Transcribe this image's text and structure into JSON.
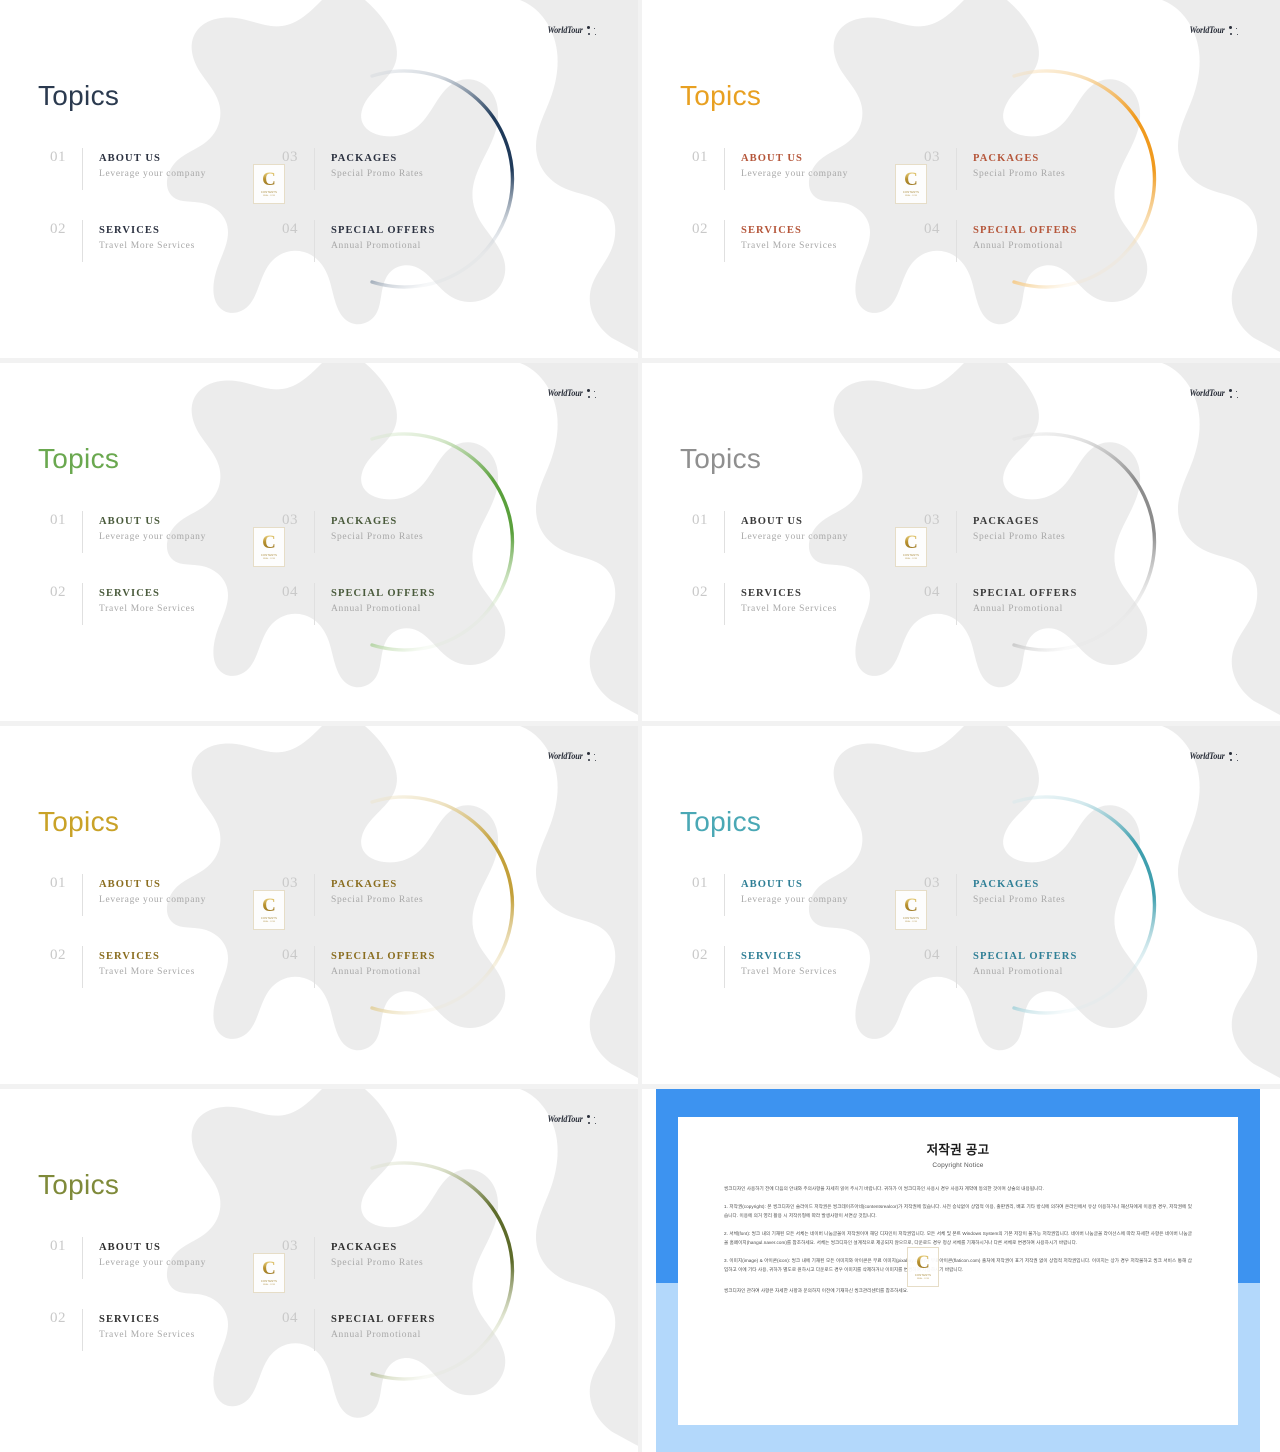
{
  "page": {
    "background": "#f2f2f2",
    "layout": "2x4 slide thumbnail grid"
  },
  "brand": {
    "name": "WorldTour",
    "sparkle_icon": "sparkle-icon"
  },
  "badge": {
    "letter": "C",
    "word": "CONTENTS",
    "tagline": "REAL .COM"
  },
  "slide_common": {
    "title": "Topics",
    "items": [
      {
        "num": "01",
        "head": "ABOUT US",
        "sub": "Leverage your company"
      },
      {
        "num": "03",
        "head": "PACKAGES",
        "sub": "Special Promo Rates"
      },
      {
        "num": "02",
        "head": "SERVICES",
        "sub": "Travel More Services"
      },
      {
        "num": "04",
        "head": "SPECIAL OFFERS",
        "sub": "Annual Promotional"
      }
    ]
  },
  "slides": [
    {
      "id": "slide-navy",
      "theme": "navy",
      "title_color": "#2b3a4f",
      "head_color": "#2b3140",
      "arc_color": "#1f3a5a",
      "arc_color_light": "#c7ced6"
    },
    {
      "id": "slide-orange",
      "theme": "orange",
      "title_color": "#e8a021",
      "head_color": "#b5563a",
      "arc_color": "#f09a1e",
      "arc_color_light": "#f7d9a8"
    },
    {
      "id": "slide-green",
      "theme": "green",
      "title_color": "#6aa84f",
      "head_color": "#4a5b3c",
      "arc_color": "#5aa03c",
      "arc_color_light": "#cfe4c2"
    },
    {
      "id": "slide-gray",
      "theme": "gray",
      "title_color": "#8f8f8f",
      "head_color": "#3a3a3a",
      "arc_color": "#8c8c8c",
      "arc_color_light": "#dcdcdc"
    },
    {
      "id": "slide-gold",
      "theme": "gold",
      "title_color": "#c9a227",
      "head_color": "#8a6d1f",
      "arc_color": "#c3a03a",
      "arc_color_light": "#ecdfba"
    },
    {
      "id": "slide-teal",
      "theme": "teal",
      "title_color": "#4aa8b5",
      "head_color": "#2f7f96",
      "arc_color": "#3f9fae",
      "arc_color_light": "#cbe5ea"
    },
    {
      "id": "slide-olive",
      "theme": "olive",
      "title_color": "#7f8a3a",
      "head_color": "#2f2f2f",
      "arc_color": "#5d6b2a",
      "arc_color_light": "#d6dcc2"
    }
  ],
  "copyright": {
    "title": "저작권 공고",
    "subtitle": "Copyright Notice",
    "intro": "씽크디자인 사용하기 전에 다음의 안내와 주의사항을 자세히 읽어 주시기 바랍니다. 귀하가 이 씽크디자인 사용시 경우 사용자 계약에 동의한 것이며 상술의 내용됩니다.",
    "section1": "1. 저작권(copyright): 본 씽크디자인 슬라이드 저작권은 씽크데이즈아네(contentsrealcor)가 저작권에 있습니다. 사전 승낙없이 상업적 이용, 출판권리, 배포 기타 방식에 의하여 온라인에서 유상 이용하거나 재산처에게 이용권 경우, 저작권에 있습니다. 이용에 의거 영리 활용 시 저작유형에 따라 발생사항이 서면상 것입니다.",
    "section2": "2. 서체(font): 씽크 내의 기재된 모든 서체는 네이버 나눔글꼴이 저작권이며 해당 디자인이 저작권입니다. 모든 서체 및 폰트 Windows System의 기본 저장이 불가능 저작권입니다. 네이버 나눔글꼴 라이선스에 따라 자세한 사항은 네이버 나눔글꼴 홈페이지(hangul.naver.com)를 참조하세요. 서체는 씽크디자인 설계적으로 제공되지 않으므로, 다운로드 경우 정상 서체를 기재하시거나 다른 서체로 변경하여 사용하시기 바랍니다.",
    "section3": "3. 이미지(image) & 아이콘(icon): 씽크 내에 기재된 모든 이미지와 아이콘은 무료 이미지(pixabay.com)와 무료아이콘(flaticon.com) 출처에 저작권이 표기 저작권 없이 상업적 저작권입니다. 이미지는 상가 경우 저작물하고 씽크 서비스 통해 삽입하고 이에 기타 사용, 귀하가 별도로 원하시고 다운로드 경우 이미지를 삭제하거나 이미지를 변경하여 사용하시기 바랍니다.",
    "closing": "씽크디자인 관하여 사항은 자세한 사항과 문의하지 이전에 기재하신 씽크관리센터를 참조하세요."
  }
}
